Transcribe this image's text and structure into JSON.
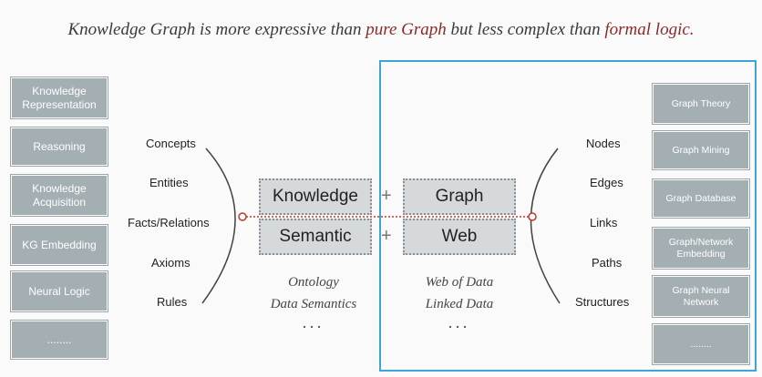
{
  "title": {
    "part1": "Knowledge Graph",
    "part2": " is more expressive than ",
    "part3": "pure Graph",
    "part4": " but less complex than ",
    "part5": "formal logic."
  },
  "left_boxes": [
    "Knowledge Representation",
    "Reasoning",
    "Knowledge Acquisition",
    "KG Embedding",
    "Neural Logic",
    "........"
  ],
  "left_labels": [
    "Concepts",
    "Entities",
    "Facts/Relations",
    "Axioms",
    "Rules"
  ],
  "center": {
    "knowledge": "Knowledge",
    "graph": "Graph",
    "semantic": "Semantic",
    "web": "Web",
    "plus": "+",
    "left_italic": [
      "Ontology",
      "Data Semantics"
    ],
    "right_italic": [
      "Web of Data",
      "Linked Data"
    ],
    "ellipsis": "···"
  },
  "right_labels": [
    "Nodes",
    "Edges",
    "Links",
    "Paths",
    "Structures"
  ],
  "right_boxes": [
    "Graph Theory",
    "Graph Mining",
    "Graph Database",
    "Graph/Network Embedding",
    "Graph Neural Network",
    "........"
  ],
  "colors": {
    "box": "#a4afb4",
    "frame": "#3ea6d6",
    "accent": "#c0392b"
  }
}
